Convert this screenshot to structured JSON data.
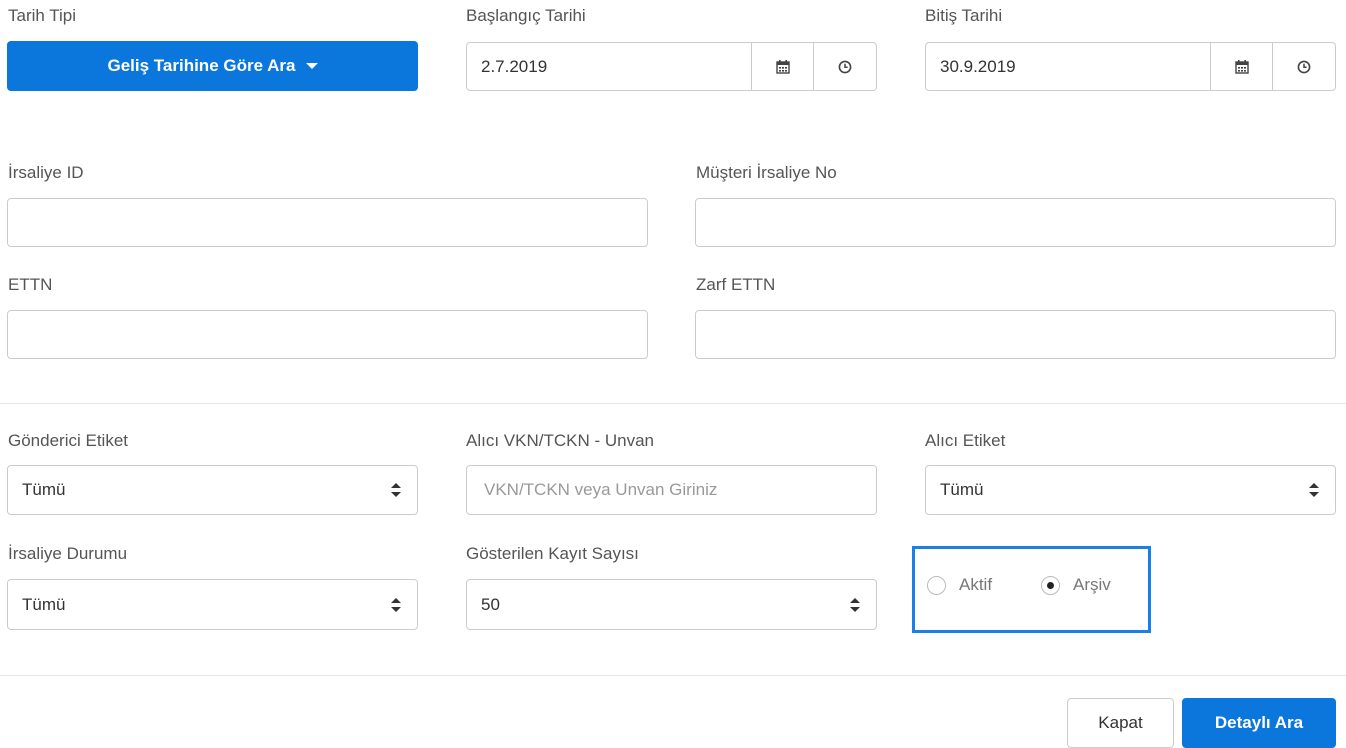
{
  "date_type": {
    "label": "Tarih Tipi",
    "button": "Geliş Tarihine Göre Ara"
  },
  "start_date": {
    "label": "Başlangıç Tarihi",
    "value": "2.7.2019"
  },
  "end_date": {
    "label": "Bitiş Tarihi",
    "value": "30.9.2019"
  },
  "irsaliye_id": {
    "label": "İrsaliye ID",
    "value": ""
  },
  "musteri_irsaliye_no": {
    "label": "Müşteri İrsaliye No",
    "value": ""
  },
  "ettn": {
    "label": "ETTN",
    "value": ""
  },
  "zarf_ettn": {
    "label": "Zarf ETTN",
    "value": ""
  },
  "gonderici_etiket": {
    "label": "Gönderici Etiket",
    "value": "Tümü"
  },
  "alici_vkn": {
    "label": "Alıcı VKN/TCKN - Unvan",
    "placeholder": "VKN/TCKN veya Unvan Giriniz"
  },
  "alici_etiket": {
    "label": "Alıcı Etiket",
    "value": "Tümü"
  },
  "irsaliye_durumu": {
    "label": "İrsaliye Durumu",
    "value": "Tümü"
  },
  "kayit_sayisi": {
    "label": "Gösterilen Kayıt Sayısı",
    "value": "50"
  },
  "scope": {
    "options": [
      "Aktif",
      "Arşiv"
    ],
    "selected": "Arşiv"
  },
  "footer": {
    "close": "Kapat",
    "search": "Detaylı Ara"
  },
  "colors": {
    "primary": "#0b76db",
    "highlight": "#1a7fe8"
  }
}
